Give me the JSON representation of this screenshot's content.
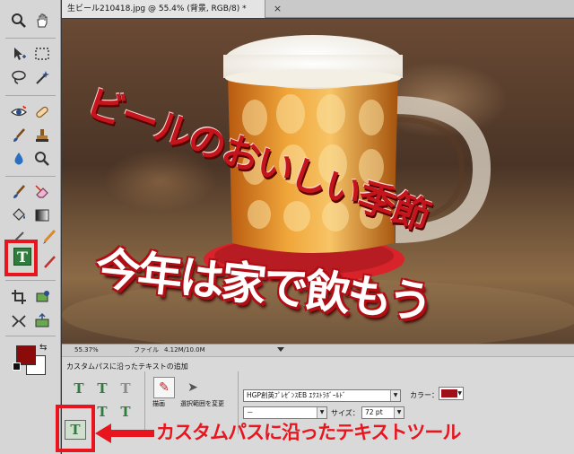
{
  "document": {
    "tab_title": "生ビール210418.jpg @ 55.4% (背景, RGB/8) *",
    "close_glyph": "×"
  },
  "image_text": {
    "headline_1": "ビールのおいしい季節",
    "headline_2": "今年は家で飲もう"
  },
  "status_bar": {
    "zoom": "55.37%",
    "file_label": "ファイル",
    "file_size": "4.12M/10.0M"
  },
  "toolbar": {
    "tools": [
      {
        "name": "zoom-tool",
        "icon": "magnifier-icon"
      },
      {
        "name": "hand-tool",
        "icon": "hand-icon"
      },
      {
        "name": "move-tool",
        "icon": "move-icon"
      },
      {
        "name": "marquee-tool",
        "icon": "marquee-icon"
      },
      {
        "name": "lasso-tool",
        "icon": "lasso-icon"
      },
      {
        "name": "magic-wand-tool",
        "icon": "wand-icon"
      },
      {
        "name": "red-eye-tool",
        "icon": "eye-icon"
      },
      {
        "name": "healing-tool",
        "icon": "bandage-icon"
      },
      {
        "name": "smart-brush-tool",
        "icon": "brush-icon"
      },
      {
        "name": "clone-stamp-tool",
        "icon": "stamp-icon"
      },
      {
        "name": "blur-tool",
        "icon": "drop-icon"
      },
      {
        "name": "sponge-tool",
        "icon": "sponge-icon"
      },
      {
        "name": "brush-tool",
        "icon": "brush-icon"
      },
      {
        "name": "eraser-tool",
        "icon": "eraser-icon"
      },
      {
        "name": "paint-bucket-tool",
        "icon": "bucket-icon"
      },
      {
        "name": "gradient-tool",
        "icon": "gradient-icon"
      },
      {
        "name": "eyedropper-tool",
        "icon": "eyedropper-icon"
      },
      {
        "name": "pencil-tool",
        "icon": "pencil-icon"
      },
      {
        "name": "type-tool",
        "icon": "type-icon"
      },
      {
        "name": "crop-tool",
        "icon": "crop-icon"
      },
      {
        "name": "recompose-tool",
        "icon": "recompose-icon"
      },
      {
        "name": "straighten-tool",
        "icon": "straighten-icon"
      },
      {
        "name": "content-move-tool",
        "icon": "content-move-icon"
      }
    ],
    "type_tool_glyph": "T",
    "foreground_color": "#8b0a0a",
    "background_color": "#ffffff"
  },
  "options": {
    "title": "カスタムパスに沿ったテキストの追加",
    "draw_label": "描画",
    "select_label": "選択範囲を変更",
    "font_family": "HGP創英ﾌﾟﾚｾﾞﾝｽEB ｴｸｽﾄﾗﾎﾞｰﾙﾄﾞ",
    "font_style": "－",
    "size_label": "サイズ：",
    "size_value": "72 pt",
    "color_label": "カラー：",
    "text_color": "#a01018",
    "dropdown_arrow": "▼",
    "type_tool_glyph": "T"
  },
  "annotation": {
    "callout_text": "カスタムパスに沿ったテキストツール",
    "highlight_color": "#e8141e"
  }
}
